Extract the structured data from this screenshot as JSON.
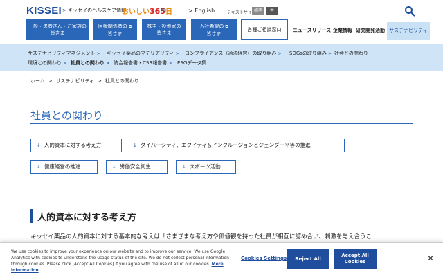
{
  "header": {
    "logo": "KISSEI",
    "health_link": "キッセイのヘルスケア情報",
    "oishii_pre": "おいしい",
    "oishii_num": "365",
    "oishii_post": "日",
    "english": "English",
    "text_size_label": "テキストサイズ",
    "size_standard": "標準",
    "size_large": "大"
  },
  "nav": {
    "patients_l1": "一般・患者さん・ご家族の",
    "patients_l2": "皆さま",
    "medical_l1": "医療関係者の",
    "medical_l2": "皆さま",
    "investors_l1": "株主・投資家の",
    "investors_l2": "皆さま",
    "recruit_l1": "入社希望の",
    "recruit_l2": "皆さま",
    "contact": "各種ご相談窓口",
    "news": "ニュースリリース",
    "corporate": "企業情報",
    "rnd": "研究開発活動",
    "sustainability": "サステナビリティ"
  },
  "subnav": {
    "items": [
      "サステナビリティマネジメント",
      "キッセイ薬品のマテリアリティ",
      "コンプライアンス（適法経営）の取り組み",
      "SDGsの取り組み",
      "社会との関わり",
      "環境との関わり",
      "社員との関わり",
      "統合報告書・CSR報告書",
      "ESGデータ集"
    ]
  },
  "breadcrumb": {
    "home": "ホーム",
    "sustainability": "サステナビリティ",
    "current": "社員との関わり"
  },
  "page": {
    "title": "社員との関わり"
  },
  "anchors": {
    "human_capital": "人的資本に対する考え方",
    "diversity": "ダイバーシティ、エクイティ＆インクルージョンとジェンダー平等の推進",
    "health": "健康経営の推進",
    "safety": "労働安全衛生",
    "sports": "スポーツ活動"
  },
  "section": {
    "title": "人的資本に対する考え方",
    "body": "キッセイ薬品の人的資本に対する基本的な考えは「さまざまな考え方や価値観を持った社員が相互に認め合い、刺激を与え合うこ"
  },
  "cookie": {
    "text": "We use cookies to improve your experience on our website and to improve our service. We use Google Analytics with cookies to understand the usage status of the site. We do not collect personal information through cookies. Please click [Accept All Cookies] if you agree with the use of all of our cookies.",
    "more": "More information",
    "settings": "Cookies Settings",
    "reject": "Reject All",
    "accept_l1": "Accept All",
    "accept_l2": "Cookies",
    "close": "✕"
  },
  "colors": {
    "brand": "#1f4e9f",
    "nav_button": "#2a67b8",
    "subnav_bg": "#cfe4f6",
    "accent_orange": "#e8890c"
  }
}
